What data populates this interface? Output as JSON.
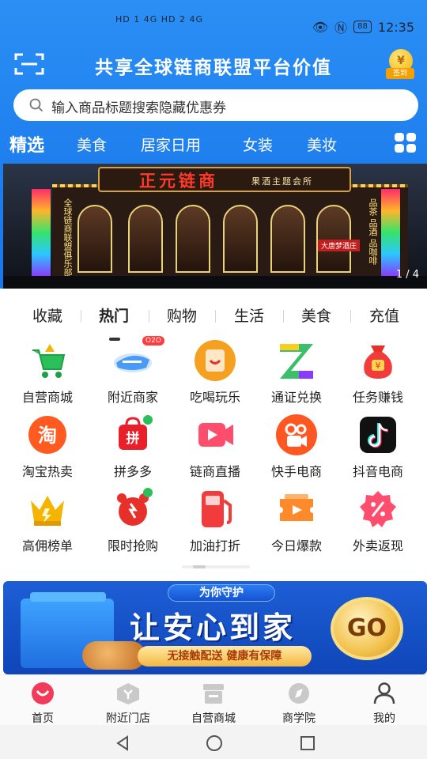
{
  "status_bar": {
    "network": "HD 1 4G  HD 2 4G",
    "battery": "88",
    "time": "12:35"
  },
  "header": {
    "title": "共享全球链商联盟平台价值",
    "sign_in_label": "签到",
    "coin_symbol": "¥"
  },
  "search": {
    "placeholder": "输入商品标题搜索隐藏优惠券"
  },
  "categories": {
    "items": [
      "精选",
      "美食",
      "居家日用",
      "女装",
      "美妆"
    ],
    "active_index": 0
  },
  "banner": {
    "sign_main": "正元链商",
    "sign_sub": "果酒主题会所",
    "left_vertical": "全球链商联盟俱乐部",
    "right_vertical": "品茶 品酒 品咖啡",
    "store_sign": "大唐梦酒庄",
    "page_indicator": "1 / 4"
  },
  "tabs": {
    "items": [
      "收藏",
      "热门",
      "购物",
      "生活",
      "美食",
      "充值"
    ],
    "active_index": 1
  },
  "grid": {
    "items": [
      {
        "label": "自营商城",
        "icon": "shopping-cart-icon",
        "color": "#2bbf5a"
      },
      {
        "label": "附近商家",
        "icon": "airplane-icon",
        "color": "#4a9bf5",
        "badge": "O2O"
      },
      {
        "label": "吃喝玩乐",
        "icon": "smile-bag-icon",
        "color": "#f5a020"
      },
      {
        "label": "通证兑换",
        "icon": "z-token-icon",
        "color": "#3cbf6a"
      },
      {
        "label": "任务赚钱",
        "icon": "money-bag-icon",
        "color": "#e8302a"
      },
      {
        "label": "淘宝热卖",
        "icon": "taobao-icon",
        "color": "#ff5a1f"
      },
      {
        "label": "拼多多",
        "icon": "pinduoduo-icon",
        "color": "#e8202a"
      },
      {
        "label": "链商直播",
        "icon": "play-icon",
        "color": "#ff4d6d"
      },
      {
        "label": "快手电商",
        "icon": "kuaishou-icon",
        "color": "#ff5722"
      },
      {
        "label": "抖音电商",
        "icon": "douyin-icon",
        "color": "#111111"
      },
      {
        "label": "高佣榜单",
        "icon": "crown-icon",
        "color": "#f5b400"
      },
      {
        "label": "限时抢购",
        "icon": "alarm-clock-icon",
        "color": "#e8302a"
      },
      {
        "label": "加油打折",
        "icon": "fuel-pump-icon",
        "color": "#f23b3b"
      },
      {
        "label": "今日爆款",
        "icon": "ticket-icon",
        "color": "#ff8a2b"
      },
      {
        "label": "外卖返现",
        "icon": "percent-badge-icon",
        "color": "#ff4d6d"
      }
    ]
  },
  "promo": {
    "tagline": "为你守护",
    "headline": "让安心到家",
    "subline": "无接触配送 健康有保障",
    "go_label": "GO"
  },
  "bottom_nav": {
    "items": [
      {
        "label": "首页",
        "icon": "home-smile-icon",
        "active": true
      },
      {
        "label": "附近门店",
        "icon": "store-cube-icon",
        "active": false
      },
      {
        "label": "自营商城",
        "icon": "shop-icon",
        "active": false
      },
      {
        "label": "商学院",
        "icon": "compass-icon",
        "active": false
      },
      {
        "label": "我的",
        "icon": "user-icon",
        "active": false
      }
    ]
  },
  "colors": {
    "header_blue": "#1f7fee",
    "accent_red": "#f23b3b"
  }
}
